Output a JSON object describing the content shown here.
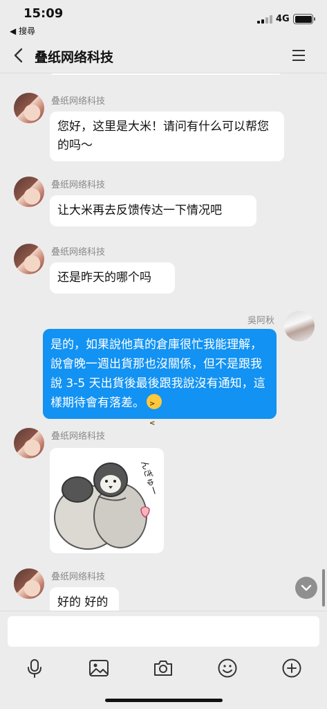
{
  "status_bar": {
    "time": "15:09",
    "back_app": "◀ 搜尋",
    "network": "4G"
  },
  "navbar": {
    "title": "叠纸网络科技"
  },
  "messages": [
    {
      "sender": "叠纸网络科技",
      "text": "您好，这里是大米！请问有什么可以帮您的吗～"
    },
    {
      "sender": "叠纸网络科技",
      "text": "让大米再去反馈传达一下情况吧"
    },
    {
      "sender": "叠纸网络科技",
      "text": "还是昨天的哪个吗"
    },
    {
      "sender": "吳阿秋",
      "text": "是的，如果說他真的倉庫很忙我能理解，說會晚一週出貨那也沒關係，但不是跟我說 3-5 天出貨後最後跟我說沒有通知，這樣期待會有落差。"
    },
    {
      "sender": "叠纸网络科技",
      "sticker_text": "んぎゅー"
    },
    {
      "sender": "叠纸网络科技",
      "text": "好的 好的"
    }
  ],
  "composer": {
    "placeholder": ""
  },
  "colors": {
    "background": "#ececec",
    "my_bubble": "#1292f2",
    "their_bubble": "#ffffff"
  },
  "icons": [
    "voice-icon",
    "image-icon",
    "camera-icon",
    "emoji-icon",
    "plus-icon"
  ]
}
